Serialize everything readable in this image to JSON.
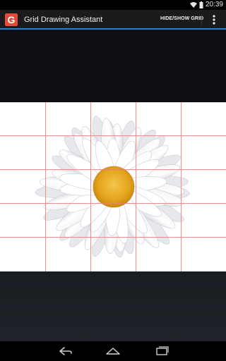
{
  "status_bar": {
    "time": "20:39"
  },
  "app": {
    "title": "Grid Drawing Assistant",
    "logo_letter": "G"
  },
  "toolbar": {
    "grid_toggle_label": "HIDE/SHOW GRID"
  },
  "colors": {
    "accent": "#2f7fc7",
    "grid_line": "#f07a7a",
    "logo": "#e64a3b",
    "flower_center": "#e4a51a"
  },
  "icons": {
    "back": "back-icon",
    "home": "home-icon",
    "recents": "recents-icon",
    "overflow": "overflow-menu-icon"
  }
}
